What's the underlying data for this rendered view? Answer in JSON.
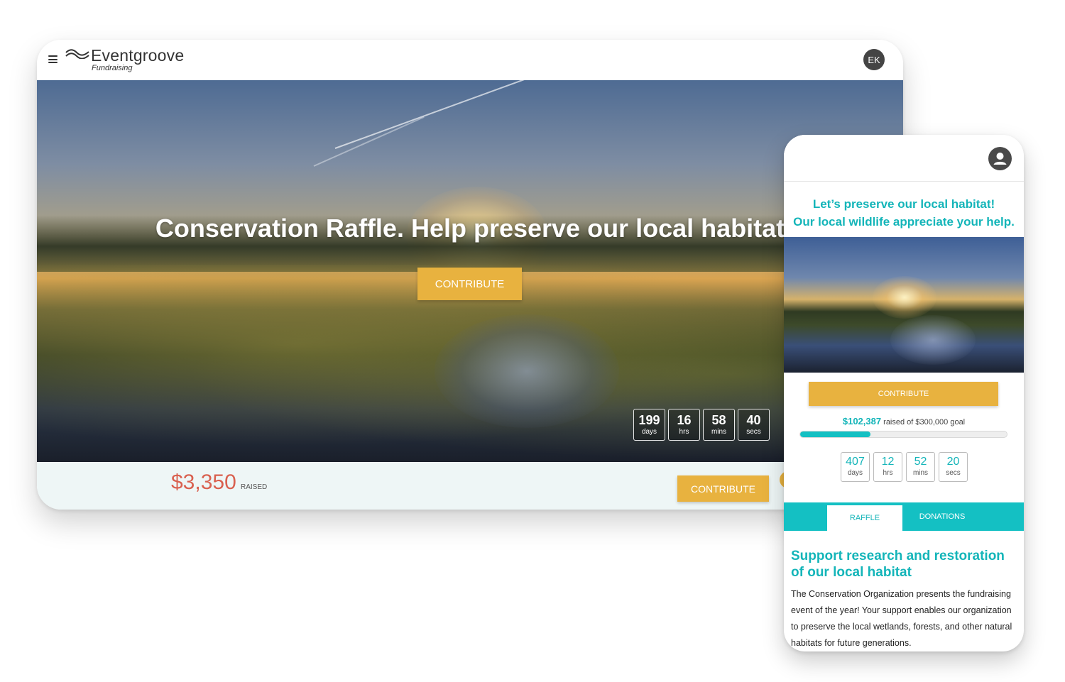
{
  "tablet": {
    "logo": {
      "name": "Eventgroove",
      "subtitle": "Fundraising"
    },
    "user_initials": "EK",
    "hero": {
      "title": "Conservation Raffle. Help preserve our local habitat",
      "cta_label": "CONTRIBUTE"
    },
    "countdown": [
      {
        "value": "199",
        "unit": "days"
      },
      {
        "value": "16",
        "unit": "hrs"
      },
      {
        "value": "58",
        "unit": "mins"
      },
      {
        "value": "40",
        "unit": "secs"
      }
    ],
    "footer": {
      "raised_amount": "$3,350",
      "raised_label": "RAISED",
      "cta_label": "CONTRIBUTE"
    }
  },
  "phone": {
    "headline_line1": "Let’s preserve our local habitat!",
    "headline_line2": "Our local wildlife appreciate your help.",
    "cta_label": "CONTRIBUTE",
    "progress": {
      "raised": "$102,387",
      "text": " raised of $300,000 goal",
      "fraction": 0.3413
    },
    "countdown": [
      {
        "value": "407",
        "unit": "days"
      },
      {
        "value": "12",
        "unit": "hrs"
      },
      {
        "value": "52",
        "unit": "mins"
      },
      {
        "value": "20",
        "unit": "secs"
      }
    ],
    "tabs": [
      {
        "label": "RAFFLE",
        "active": true
      },
      {
        "label": "DONATIONS",
        "active": false
      }
    ],
    "section_title": "Support research and restoration of our local habitat",
    "body": "The Conservation Organization presents the fundraising event of the year! Your support enables our organization to preserve the local wetlands, forests, and other natural habitats for future generations."
  },
  "colors": {
    "accent_gold": "#e8b23f",
    "teal": "#14c0c3",
    "raised_red": "#d9604f"
  },
  "icons": {
    "menu": "hamburger-icon",
    "logo_mark": "wave-logo-icon",
    "user": "user-avatar-icon"
  }
}
